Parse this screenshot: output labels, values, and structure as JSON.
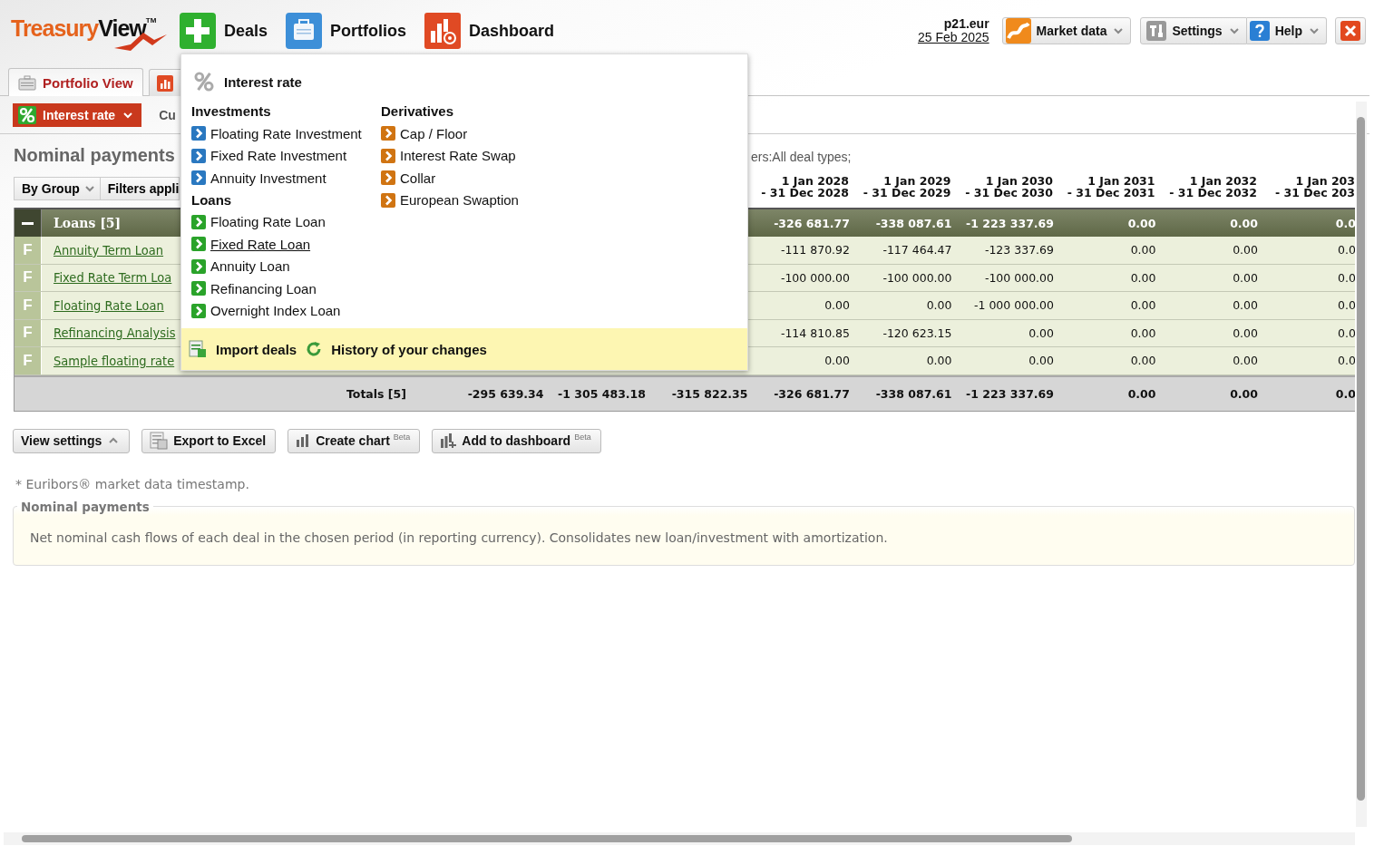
{
  "header": {
    "logo_primary": "Treasury",
    "logo_secondary": "View",
    "logo_mark": "TM",
    "nav": [
      {
        "label": "Deals",
        "kind": "deals"
      },
      {
        "label": "Portfolios",
        "kind": "portfolios"
      },
      {
        "label": "Dashboard",
        "kind": "dashboard"
      }
    ],
    "account": "p21.eur",
    "date": "25 Feb 2025",
    "buttons": [
      {
        "label": "Market data",
        "kind": "market"
      },
      {
        "label": "Settings",
        "kind": "settings"
      },
      {
        "label": "Help",
        "kind": "help"
      },
      {
        "kind": "close"
      }
    ]
  },
  "tabs": [
    {
      "label": "Portfolio View",
      "kind": "portfolio",
      "selected": true
    },
    {
      "kind": "chart",
      "selected": false
    }
  ],
  "subbar": {
    "category": "Interest rate",
    "cut_text": "Cu"
  },
  "report": {
    "title": "Nominal payments",
    "filter_summary": "ers:All deal types;",
    "table": {
      "grouping": "By Group",
      "filters_button": "Filters appli",
      "columns": [
        {
          "from": "1 Jan 2028",
          "to": "- 31 Dec 2028"
        },
        {
          "from": "1 Jan 2029",
          "to": "- 31 Dec 2029"
        },
        {
          "from": "1 Jan 2030",
          "to": "- 31 Dec 2030"
        },
        {
          "from": "1 Jan 2031",
          "to": "- 31 Dec 2031"
        },
        {
          "from": "1 Jan 2032",
          "to": "- 31 Dec 2032"
        },
        {
          "from": "1 Jan 203",
          "to": "- 31 Dec 203"
        }
      ],
      "group": {
        "label": "Loans [5]",
        "expanded": true,
        "values": [
          "-326 681.77",
          "-338 087.61",
          "-1 223 337.69",
          "0.00",
          "0.00",
          "0.0"
        ]
      },
      "rows": [
        {
          "type": "F",
          "name": "Annuity Term Loan",
          "values": [
            "-111 870.92",
            "-117 464.47",
            "-123 337.69",
            "0.00",
            "0.00",
            "0.0"
          ]
        },
        {
          "type": "F",
          "name": "Fixed Rate Term Loa",
          "values": [
            "-100 000.00",
            "-100 000.00",
            "-100 000.00",
            "0.00",
            "0.00",
            "0.0"
          ]
        },
        {
          "type": "F",
          "name": "Floating Rate Loan",
          "values": [
            "0.00",
            "0.00",
            "-1 000 000.00",
            "0.00",
            "0.00",
            "0.0"
          ]
        },
        {
          "type": "F",
          "name": "Refinancing Analysis",
          "values": [
            "-114 810.85",
            "-120 623.15",
            "0.00",
            "0.00",
            "0.00",
            "0.0"
          ]
        },
        {
          "type": "F",
          "name": "Sample floating rate",
          "values": [
            "0.00",
            "0.00",
            "0.00",
            "0.00",
            "0.00",
            "0.0"
          ]
        }
      ],
      "totals": {
        "label": "Totals [5]",
        "values": [
          "-295 639.34",
          "-1 305 483.18",
          "-315 822.35",
          "-326 681.77",
          "-338 087.61",
          "-1 223 337.69",
          "0.00",
          "0.00",
          "0.0"
        ]
      }
    }
  },
  "actions": [
    {
      "label": "View settings",
      "kind": "view-settings"
    },
    {
      "label": "Export to Excel",
      "kind": "excel"
    },
    {
      "label": "Create chart",
      "badge": "Beta",
      "kind": "chart"
    },
    {
      "label": "Add to dashboard",
      "badge": "Beta",
      "kind": "dashboard"
    }
  ],
  "footnote": "* Euribors® market data timestamp.",
  "info": {
    "legend": "Nominal payments",
    "text": "Net nominal cash flows of each deal in the chosen period (in reporting currency). Consolidates new loan/investment with amortization."
  },
  "menu": {
    "title": "Interest rate",
    "columns": [
      {
        "sections": [
          {
            "heading": "Investments",
            "kind": "investment",
            "items": [
              {
                "label": "Floating Rate Investment",
                "hovered": false
              },
              {
                "label": "Fixed Rate Investment",
                "hovered": false
              },
              {
                "label": "Annuity Investment",
                "hovered": false
              }
            ]
          },
          {
            "heading": "Loans",
            "kind": "loan",
            "items": [
              {
                "label": "Floating Rate Loan",
                "hovered": false
              },
              {
                "label": "Fixed Rate Loan",
                "hovered": true
              },
              {
                "label": "Annuity Loan",
                "hovered": false
              },
              {
                "label": "Refinancing Loan",
                "hovered": false
              },
              {
                "label": "Overnight Index Loan",
                "hovered": false
              }
            ]
          }
        ]
      },
      {
        "sections": [
          {
            "heading": "Derivatives",
            "kind": "derivative",
            "items": [
              {
                "label": "Cap / Floor",
                "hovered": false
              },
              {
                "label": "Interest Rate Swap",
                "hovered": false
              },
              {
                "label": "Collar",
                "hovered": false
              },
              {
                "label": "European Swaption",
                "hovered": false
              }
            ]
          }
        ]
      }
    ],
    "footer": [
      {
        "label": "Import deals",
        "kind": "import"
      },
      {
        "label": "History of your changes",
        "kind": "history"
      }
    ]
  }
}
